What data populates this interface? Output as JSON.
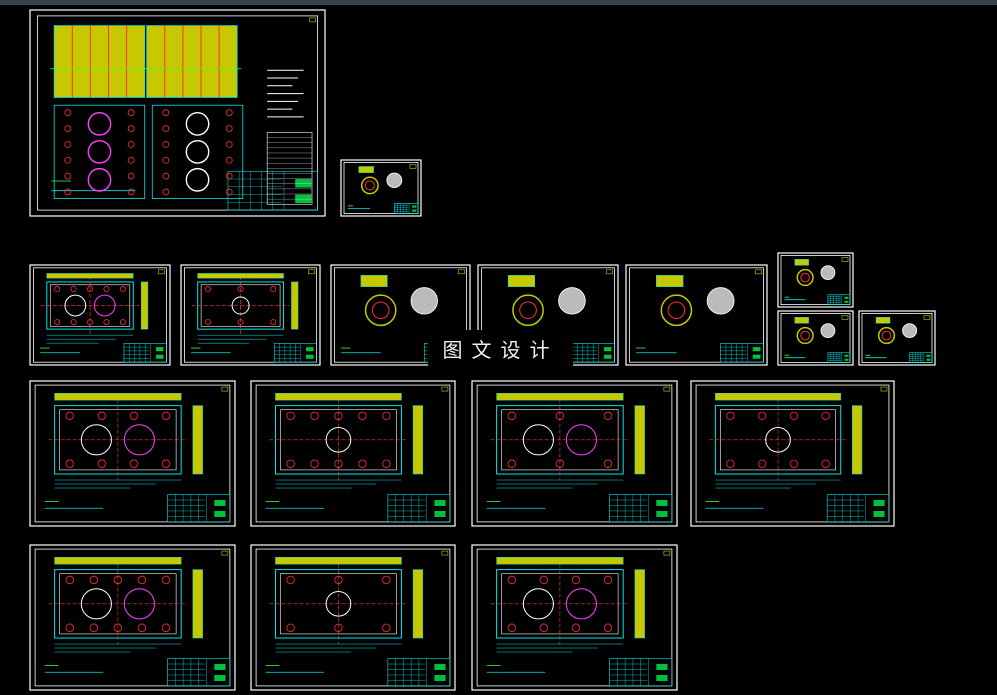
{
  "watermark": {
    "text": "图文设计"
  },
  "colors": {
    "background": "#000000",
    "frame": "#ffffff",
    "outline": "#00e5e5",
    "hole": "#ff3030",
    "section_fill": "#c8c800",
    "title_block_fill": "#00c040",
    "center_line": "#ff4040",
    "magenta": "#ff40ff",
    "green": "#40ff40"
  }
}
